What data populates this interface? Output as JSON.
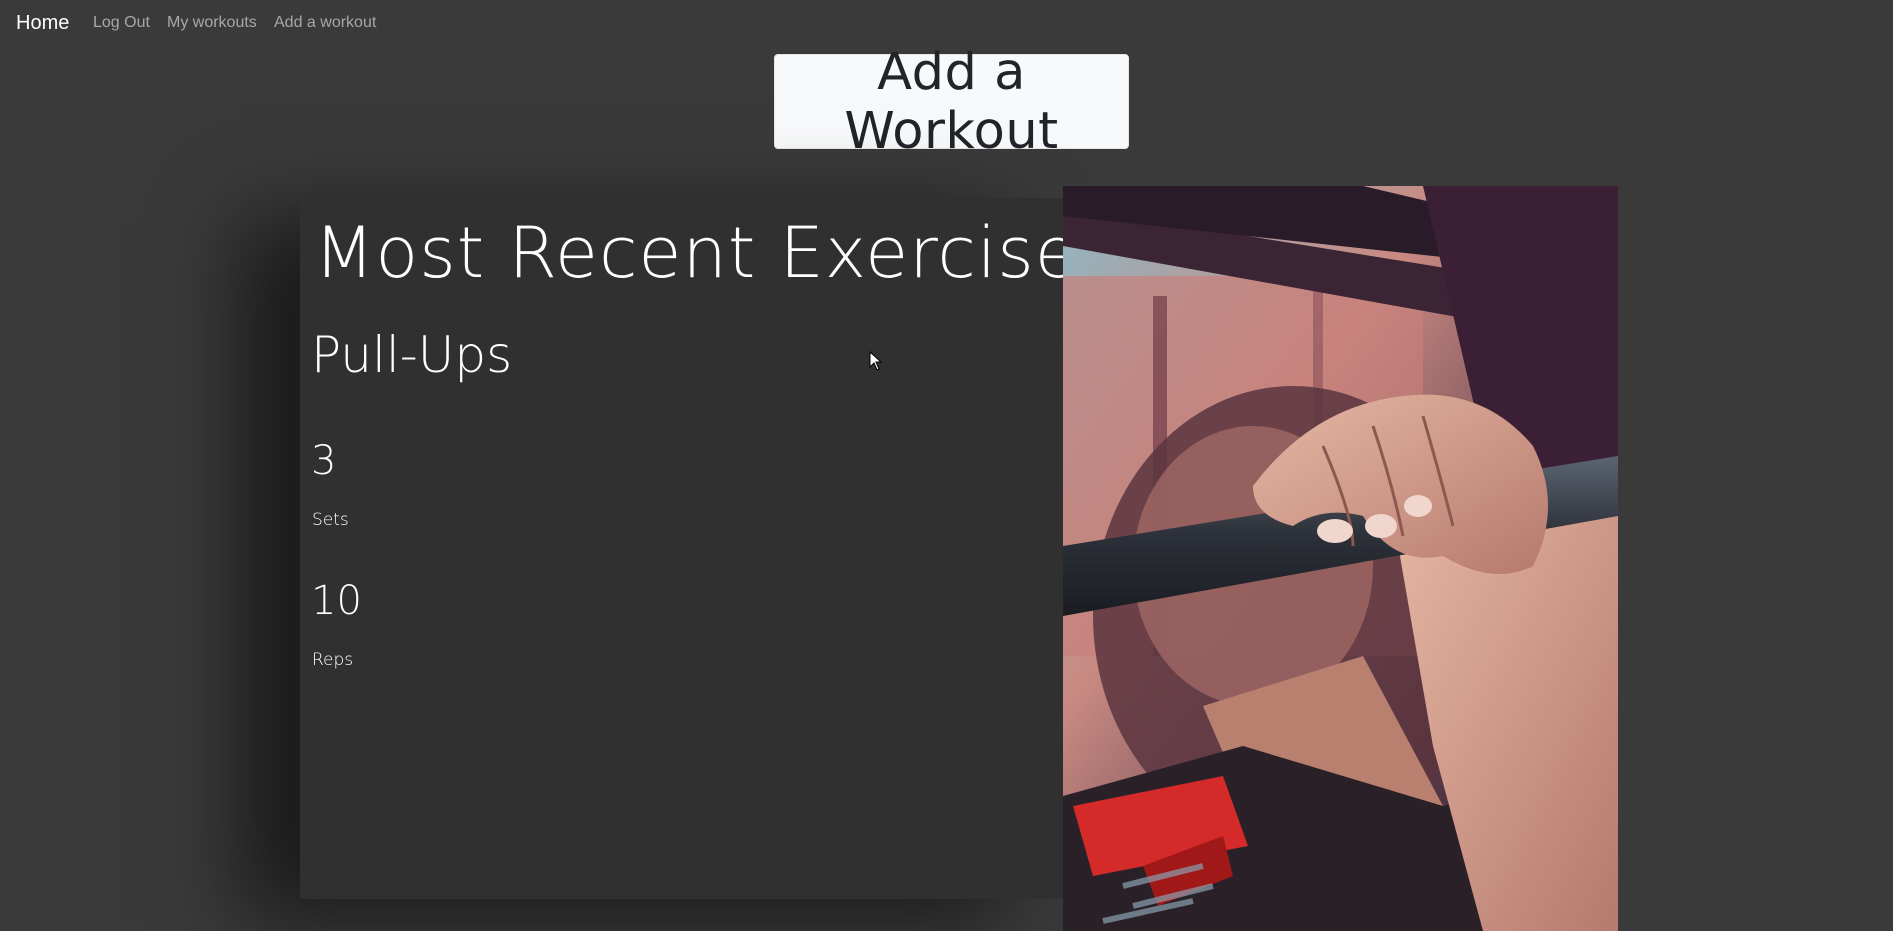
{
  "navbar": {
    "brand": "Home",
    "links": [
      "Log Out",
      "My workouts",
      "Add a workout"
    ]
  },
  "add_button_label": "Add a Workout",
  "card": {
    "title": "Most Recent Exercise",
    "exercise": "Pull-Ups",
    "sets_value": "3",
    "sets_label": "Sets",
    "reps_value": "10",
    "reps_label": "Reps"
  },
  "photo_icon": "pull-up-photo",
  "colors": {
    "background": "#3a3a3a",
    "card": "#303030",
    "button_bg": "#f8f9fa",
    "button_text": "#212529"
  }
}
